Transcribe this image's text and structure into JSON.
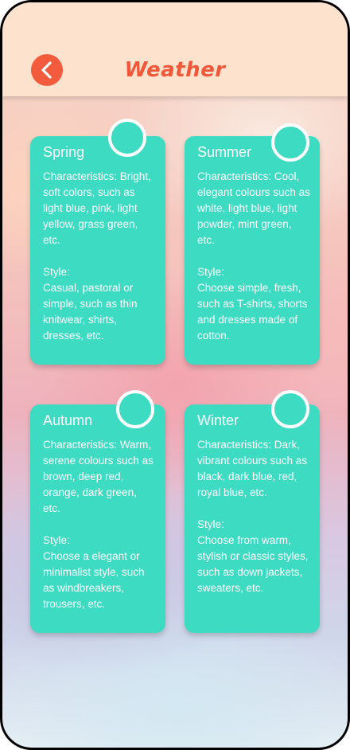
{
  "header": {
    "title": "Weather",
    "back_icon": "chevron-left-icon"
  },
  "colors": {
    "accent": "#f25c3d",
    "card": "#3ddcc2",
    "header_bg": "#fde3cd"
  },
  "seasons": [
    {
      "name": "Spring",
      "characteristics": "Characteristics: Bright, soft colors, such as light blue, pink, light yellow, grass green, etc.",
      "style_label": "Style:",
      "style": "Casual, pastoral or simple, such as thin knitwear, shirts, dresses, etc."
    },
    {
      "name": "Summer",
      "characteristics": "Characteristics: Cool, elegant colours such as white, light blue, light powder, mint green, etc.",
      "style_label": "Style:",
      "style": "Choose simple, fresh, such as T-shirts, shorts and dresses made of cotton."
    },
    {
      "name": "Autumn",
      "characteristics": "Characteristics: Warm, serene colours such as brown, deep red, orange, dark green, etc.",
      "style_label": "Style:",
      "style": "Choose a elegant or minimalist style, such as windbreakers, trousers, etc."
    },
    {
      "name": "Winter",
      "characteristics": "Characteristics: Dark, vibrant colours such as black, dark blue, red, royal blue, etc.",
      "style_label": "Style:",
      "style": "Choose from warm, stylish or classic styles, such as down jackets, sweaters, etc."
    }
  ]
}
